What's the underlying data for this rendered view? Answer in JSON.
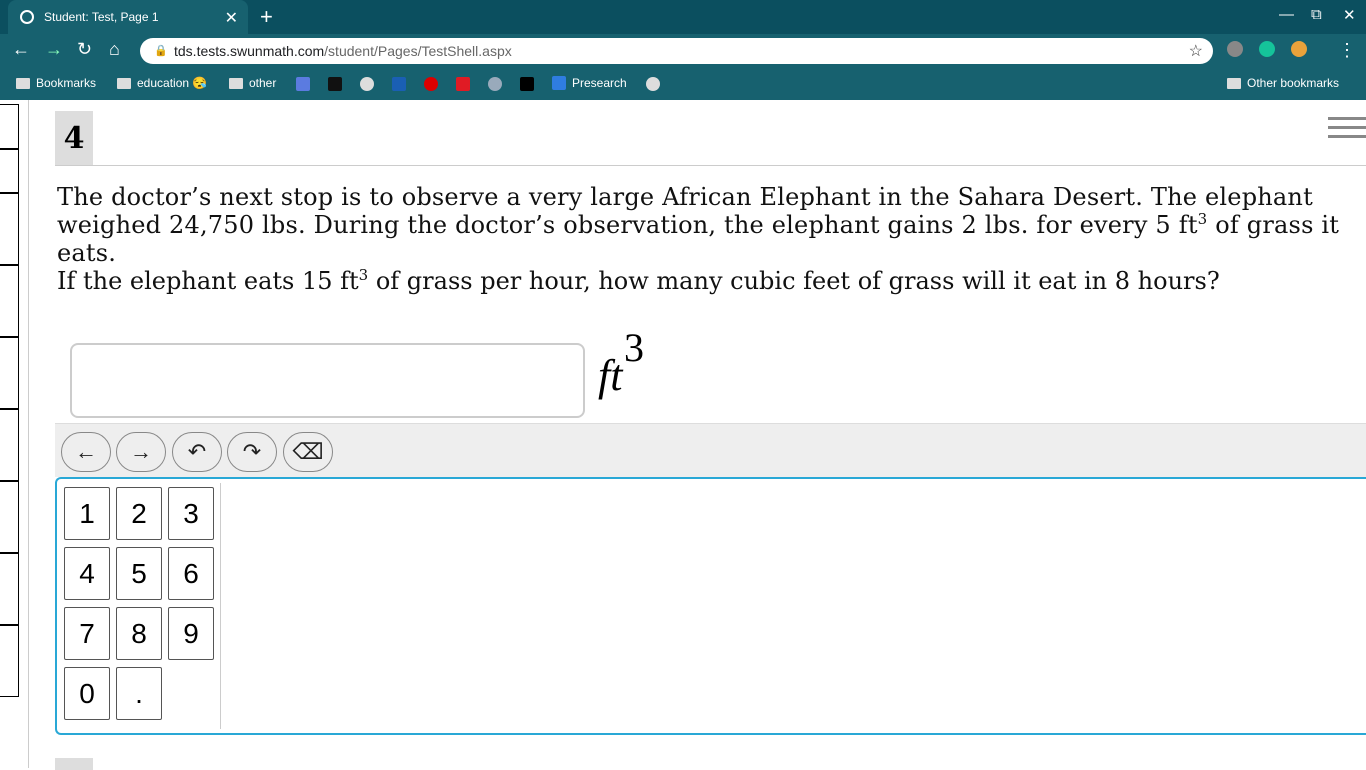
{
  "browser": {
    "tab_title": "Student: Test, Page 1",
    "url_host": "tds.tests.swunmath.com",
    "url_path": "/student/Pages/TestShell.aspx",
    "bookmarks": [
      "Bookmarks",
      "education 😪",
      "other",
      "Presearch"
    ],
    "other_bookmarks": "Other bookmarks"
  },
  "question": {
    "number": "4",
    "stem_a": "The doctor’s next stop is to observe a very large African Elephant in the Sahara Desert. The elephant weighed 24,750 lbs. During the doctor’s observation, the elephant gains 2 lbs. for every 5 ft",
    "stem_exp": "3",
    "stem_b": " of grass it eats.",
    "prompt_a": "If the elephant eats 15 ft",
    "prompt_exp": "3",
    "prompt_b": " of grass per hour, how many cubic feet of grass will it eat in 8 hours?",
    "answer_value": "",
    "unit": "ft",
    "unit_exp": "3"
  },
  "editor": {
    "buttons": [
      "←",
      "→",
      "↶",
      "↷",
      "⌫"
    ]
  },
  "keypad": {
    "keys": [
      "1",
      "2",
      "3",
      "4",
      "5",
      "6",
      "7",
      "8",
      "9",
      "0",
      "."
    ]
  }
}
